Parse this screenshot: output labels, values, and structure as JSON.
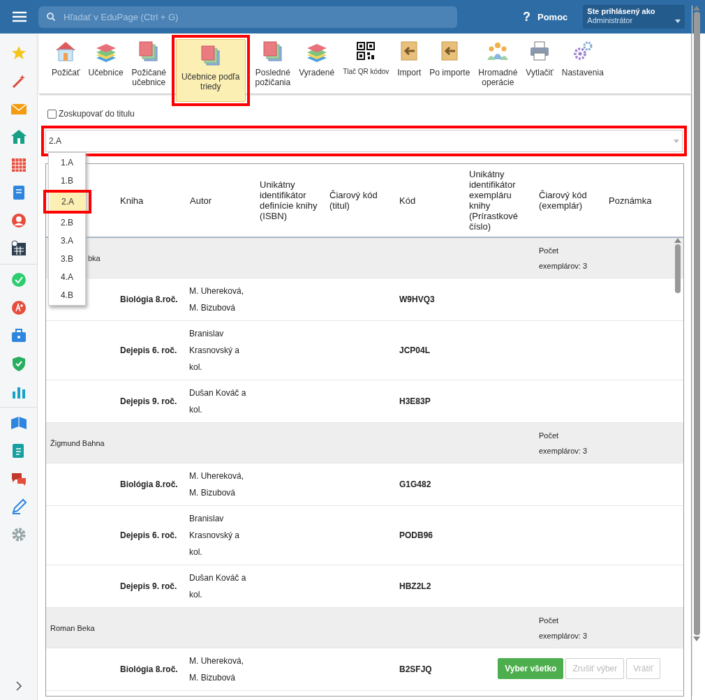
{
  "topbar": {
    "search": {
      "placeholder": "Hľadať v EduPage (Ctrl + G)"
    },
    "help": {
      "mark": "?",
      "label": "Pomoc"
    },
    "user": {
      "caption": "Ste prihlásený ako",
      "role": "Administrátor"
    }
  },
  "toolbar": [
    {
      "label": "Požičať",
      "selected": false
    },
    {
      "label": "Učebnice",
      "selected": false
    },
    {
      "label": "Požičané\nučebnice",
      "selected": false
    },
    {
      "label": "Učebnice podľa\ntriedy",
      "selected": true
    },
    {
      "label": "Posledné\npožičania",
      "selected": false
    },
    {
      "label": "Vyradené",
      "selected": false
    },
    {
      "label": "Tlač QR kódov",
      "selected": false
    },
    {
      "label": "Import",
      "selected": false
    },
    {
      "label": "Po importe",
      "selected": false
    },
    {
      "label": "Hromadné\noperácie",
      "selected": false
    },
    {
      "label": "Vytlačiť",
      "selected": false
    },
    {
      "label": "Nastavenia",
      "selected": false
    }
  ],
  "group_toggle": {
    "label": "Zoskupovať do titulu",
    "checked": false
  },
  "class_select": {
    "value": "2.A",
    "highlighted": true,
    "options": [
      {
        "label": "1.A",
        "selected": false
      },
      {
        "label": "1.B",
        "selected": false
      },
      {
        "label": "2.A",
        "selected": true
      },
      {
        "label": "2.B",
        "selected": false
      },
      {
        "label": "3.A",
        "selected": false
      },
      {
        "label": "3.B",
        "selected": false
      },
      {
        "label": "4.A",
        "selected": false
      },
      {
        "label": "4.B",
        "selected": false
      }
    ]
  },
  "table": {
    "columns": [
      "Kniha",
      "Autor",
      "Unikátny identifikátor definície knihy (ISBN)",
      "Čiarový kód (titul)",
      "Kód",
      "Unikátny identifikátor exempláru knihy (Prírastkové číslo)",
      "Čiarový kód (exemplár)",
      "Poznámka"
    ],
    "rows": [
      {
        "kind": "group",
        "name": "bka",
        "covered": true,
        "note": "Počet exemplárov: 3"
      },
      {
        "kind": "item",
        "book": "Biológia 8.roč.",
        "author": "M. Uhereková, M. Bizubová",
        "code": "W9HVQ3"
      },
      {
        "kind": "item",
        "book": "Dejepis 6. roč.",
        "author": "Branislav Krasnovský a kol.",
        "code": "JCP04L"
      },
      {
        "kind": "item",
        "book": "Dejepis 9. roč.",
        "author": "Dušan Kováč a kol.",
        "code": "H3E83P"
      },
      {
        "kind": "group",
        "name": "Žigmund Bahna",
        "note": "Počet exemplárov: 3"
      },
      {
        "kind": "item",
        "book": "Biológia 8.roč.",
        "author": "M. Uhereková, M. Bizubová",
        "code": "G1G482"
      },
      {
        "kind": "item",
        "book": "Dejepis 6. roč.",
        "author": "Branislav Krasnovský a kol.",
        "code": "PODB96"
      },
      {
        "kind": "item",
        "book": "Dejepis 9. roč.",
        "author": "Dušan Kováč a kol.",
        "code": "HBZ2L2"
      },
      {
        "kind": "group",
        "name": "Roman Beka",
        "note": "Počet exemplárov: 3"
      },
      {
        "kind": "item",
        "book": "Biológia 8.roč.",
        "author": "M. Uhereková, M. Bizubová",
        "code": "B2SFJQ"
      }
    ]
  },
  "actions": [
    {
      "label": "Vyber všetko",
      "disabled": false
    },
    {
      "label": "Zrušiť výber",
      "disabled": true
    },
    {
      "label": "Vrátiť",
      "disabled": true
    }
  ]
}
